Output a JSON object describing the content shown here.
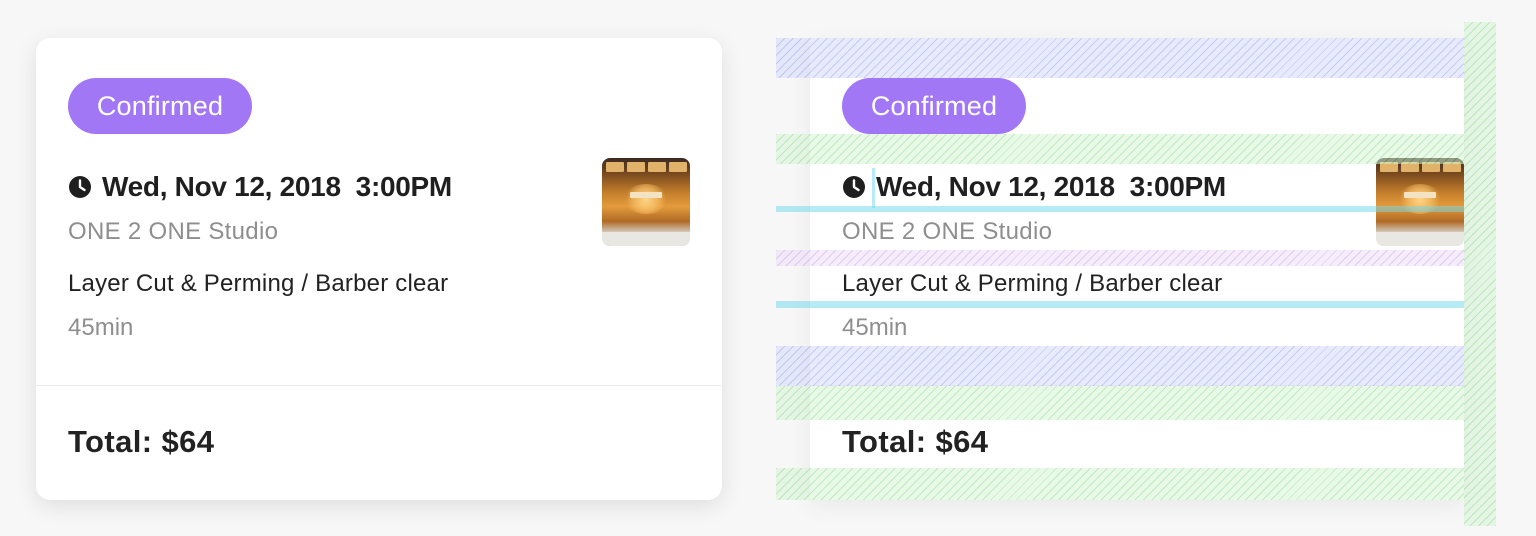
{
  "booking": {
    "status": "Confirmed",
    "datetime": "Wed, Nov 12, 2018  3:00PM",
    "studio": "ONE 2 ONE Studio",
    "service": "Layer Cut & Perming / Barber clear",
    "duration": "45min",
    "total": "Total: $64",
    "icon": "clock-icon",
    "thumbnail": "barber-shop-photo"
  },
  "colors": {
    "badge": "#a277f5",
    "background": "#f7f7f7",
    "card": "#ffffff",
    "muted_text": "#8e8e8e",
    "primary_text": "#222222"
  }
}
